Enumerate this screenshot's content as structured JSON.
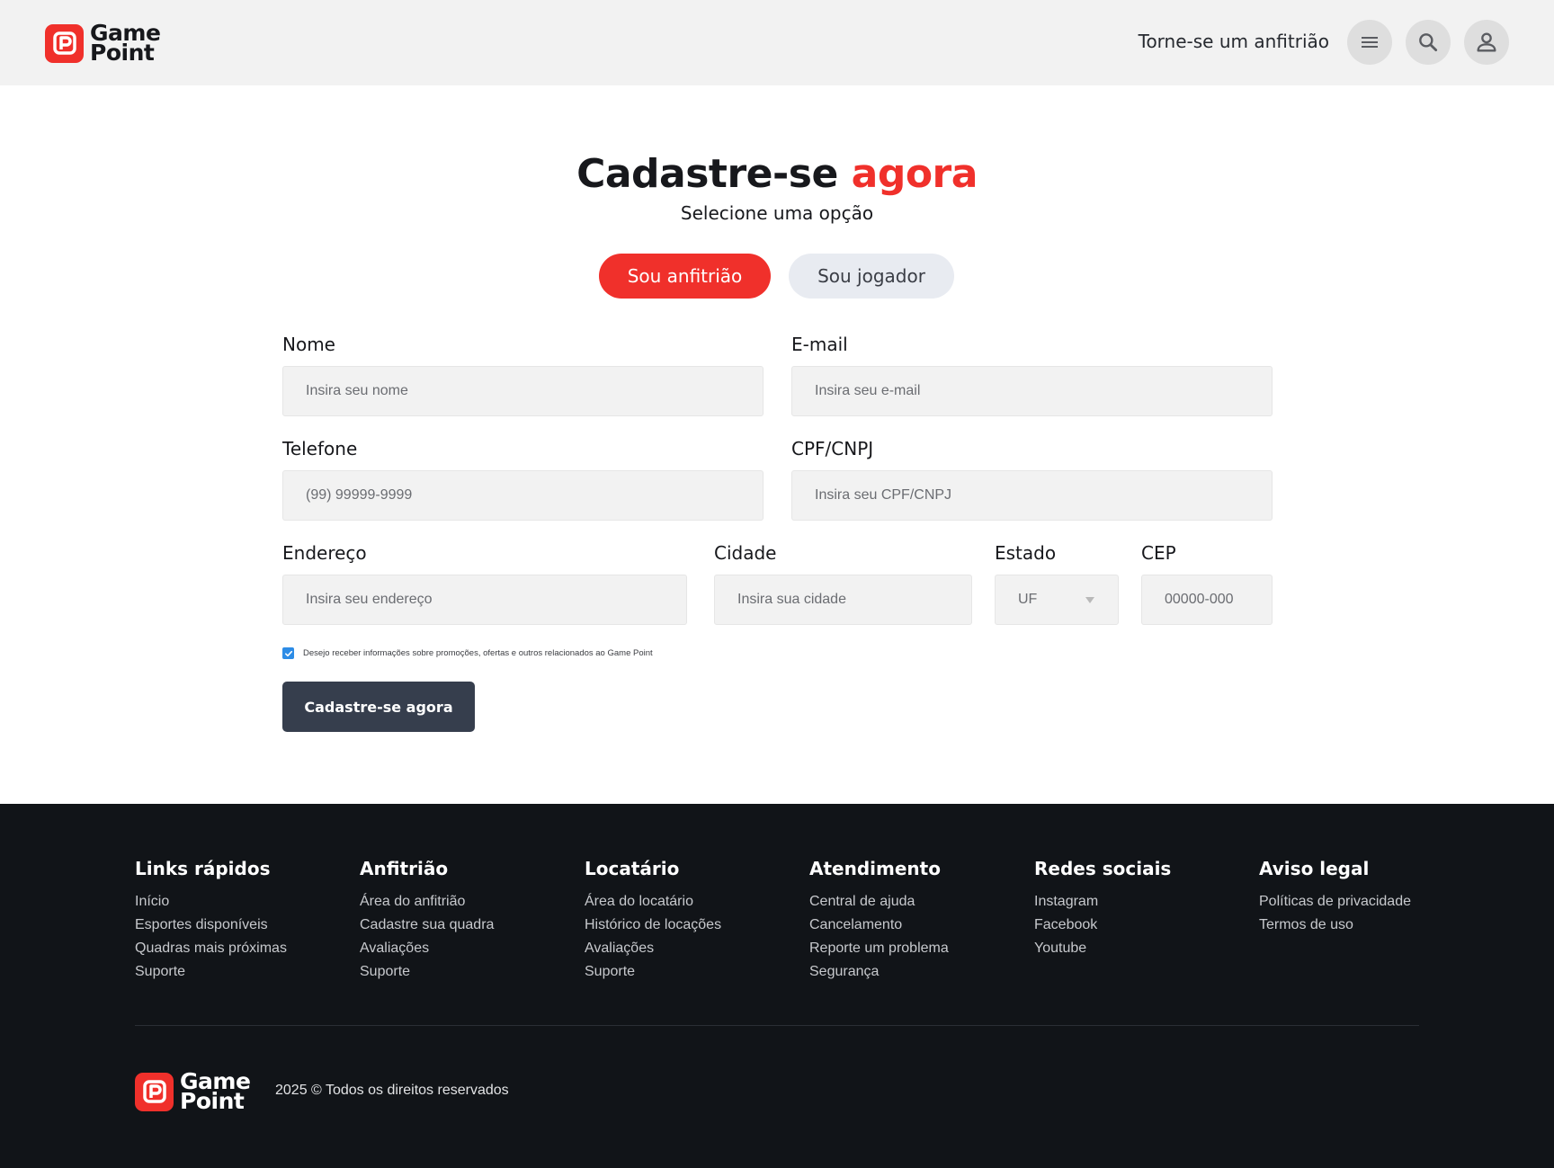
{
  "header": {
    "logo_line1": "Game",
    "logo_line2": "Point",
    "host_link": "Torne-se um anfitrião",
    "icons": [
      "menu-icon",
      "search-icon",
      "user-icon"
    ]
  },
  "hero": {
    "title_main": "Cadastre-se",
    "title_accent": "agora",
    "subtitle": "Selecione uma opção",
    "tabs": [
      {
        "label": "Sou anfitrião",
        "active": true
      },
      {
        "label": "Sou jogador",
        "active": false
      }
    ]
  },
  "form": {
    "nome": {
      "label": "Nome",
      "placeholder": "Insira seu nome"
    },
    "email": {
      "label": "E-mail",
      "placeholder": "Insira seu e-mail"
    },
    "telefone": {
      "label": "Telefone",
      "placeholder": "(99) 99999-9999"
    },
    "cpf": {
      "label": "CPF/CNPJ",
      "placeholder": "Insira seu CPF/CNPJ"
    },
    "endereco": {
      "label": "Endereço",
      "placeholder": "Insira seu endereço"
    },
    "cidade": {
      "label": "Cidade",
      "placeholder": "Insira sua cidade"
    },
    "estado": {
      "label": "Estado",
      "value": "UF"
    },
    "cep": {
      "label": "CEP",
      "placeholder": "00000-000"
    },
    "consent": {
      "checked": true,
      "label": "Desejo receber informações sobre promoções, ofertas e outros relacionados ao Game Point"
    },
    "submit_label": "Cadastre-se agora"
  },
  "colors": {
    "accent": "#f0302b",
    "submit": "#363e4d",
    "footer_bg": "#111418",
    "checkbox": "#2d8ce6"
  },
  "footer": {
    "columns": [
      {
        "title": "Links rápidos",
        "links": [
          "Início",
          "Esportes disponíveis",
          "Quadras mais próximas",
          "Suporte"
        ]
      },
      {
        "title": "Anfitrião",
        "links": [
          "Área do anfitrião",
          "Cadastre sua quadra",
          "Avaliações",
          "Suporte"
        ]
      },
      {
        "title": "Locatário",
        "links": [
          "Área do locatário",
          "Histórico de locações",
          "Avaliações",
          "Suporte"
        ]
      },
      {
        "title": "Atendimento",
        "links": [
          "Central de ajuda",
          "Cancelamento",
          "Reporte um problema",
          "Segurança"
        ]
      },
      {
        "title": "Redes sociais",
        "links": [
          "Instagram",
          "Facebook",
          "Youtube"
        ]
      },
      {
        "title": "Aviso legal",
        "links": [
          "Políticas de privacidade",
          "Termos de uso"
        ]
      }
    ],
    "logo_line1": "Game",
    "logo_line2": "Point",
    "copyright": "2025 © Todos os direitos reservados"
  }
}
